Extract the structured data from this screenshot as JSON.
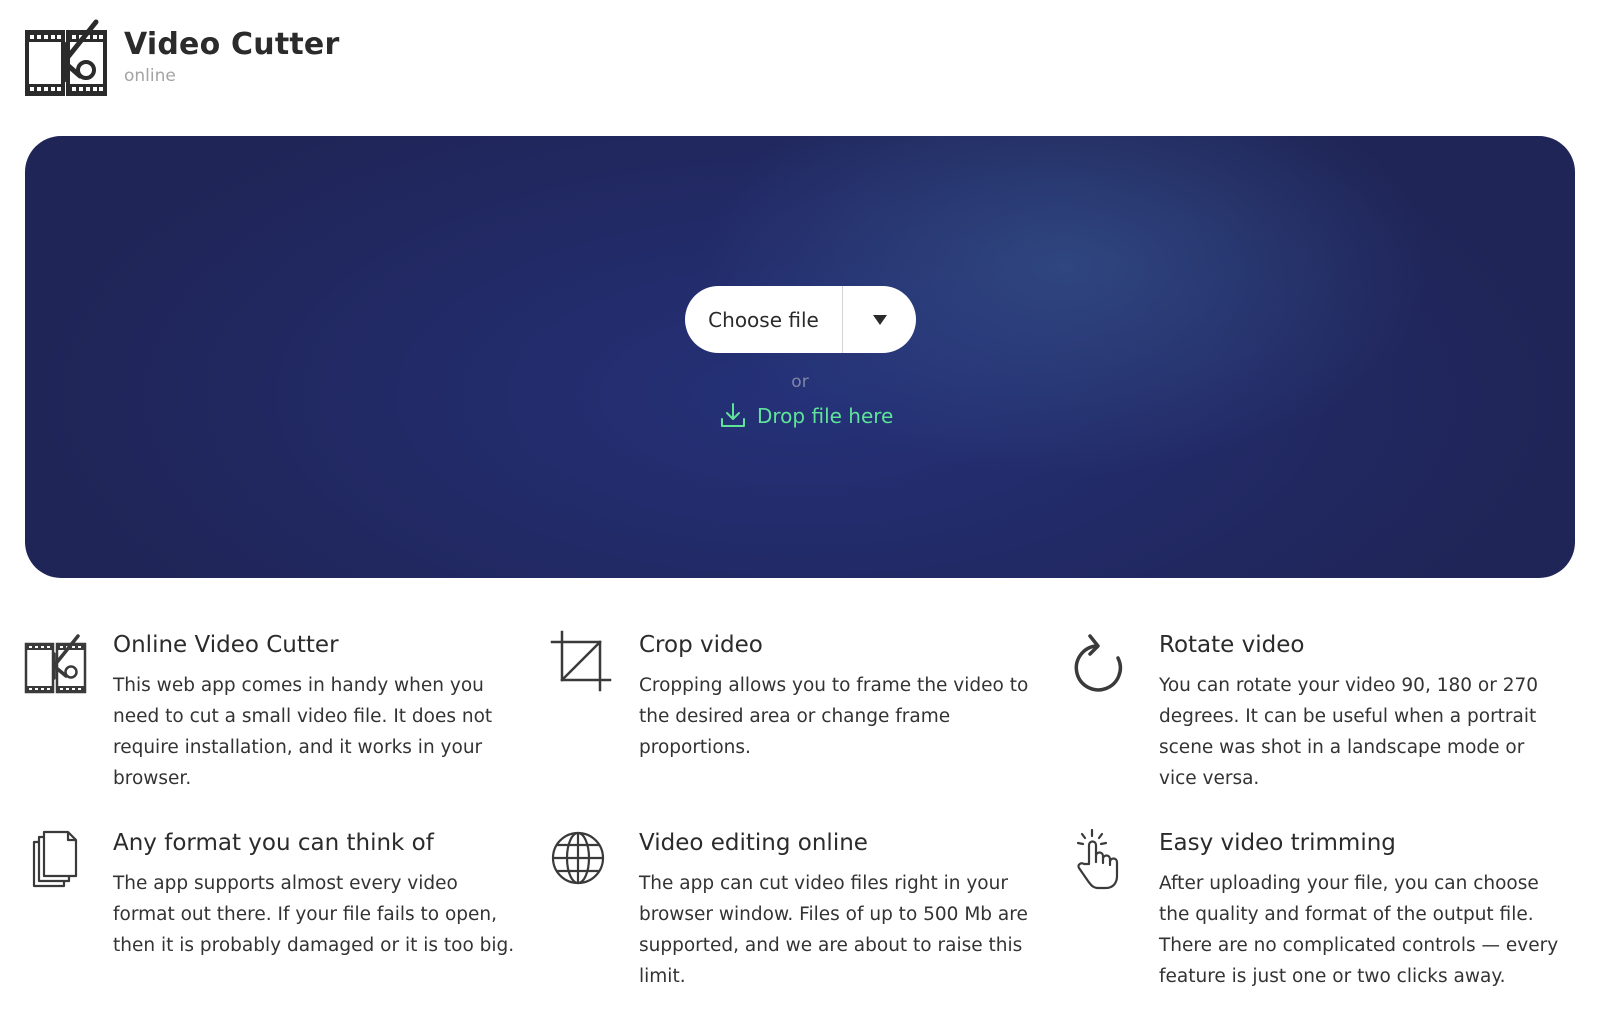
{
  "brand": {
    "title": "Video Cutter",
    "subtitle": "online",
    "logo_icon": "film-scissors-icon"
  },
  "upload": {
    "choose_label": "Choose file",
    "dropdown_icon": "caret-down-icon",
    "or_text": "or",
    "drop_label": "Drop file here",
    "drop_icon": "download-tray-icon",
    "accent_color": "#5fe39a",
    "panel_color": "#232b6a"
  },
  "features": [
    {
      "icon": "film-scissors-icon",
      "title": "Online Video Cutter",
      "text": "This web app comes in handy when you need to cut a small video file. It does not require installation, and it works in your browser."
    },
    {
      "icon": "crop-icon",
      "title": "Crop video",
      "text": "Cropping allows you to frame the video to the desired area or change frame proportions."
    },
    {
      "icon": "rotate-icon",
      "title": "Rotate video",
      "text": "You can rotate your video 90, 180 or 270 degrees. It can be useful when a portrait scene was shot in a landscape mode or vice versa."
    },
    {
      "icon": "files-stack-icon",
      "title": "Any format you can think of",
      "text": "The app supports almost every video format out there. If your file fails to open, then it is probably damaged or it is too big."
    },
    {
      "icon": "globe-icon",
      "title": "Video editing online",
      "text": "The app can cut video files right in your browser window. Files of up to 500 Mb are supported, and we are about to raise this limit."
    },
    {
      "icon": "tap-hand-icon",
      "title": "Easy video trimming",
      "text": "After uploading your file, you can choose the quality and format of the output file. There are no complicated controls — every feature is just one or two clicks away."
    }
  ]
}
